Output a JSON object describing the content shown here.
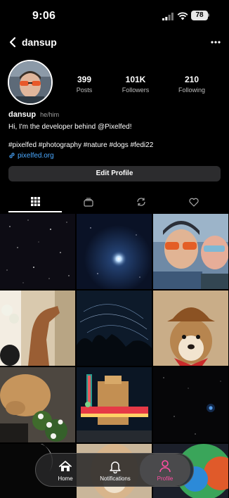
{
  "status_bar": {
    "time": "9:06",
    "battery": "78"
  },
  "header": {
    "username": "dansup"
  },
  "profile": {
    "display_name": "dansup",
    "pronouns": "he/him",
    "bio": "Hi, I'm the developer behind @Pixelfed!",
    "tags": "#pixelfed #photography #nature #dogs #fedi22",
    "link": "pixelfed.org"
  },
  "stats": [
    {
      "value": "399",
      "label": "Posts"
    },
    {
      "value": "101K",
      "label": "Followers"
    },
    {
      "value": "210",
      "label": "Following"
    }
  ],
  "edit_button": "Edit Profile",
  "tabs": [
    "grid-icon",
    "collections-icon",
    "reblog-icon",
    "heart-icon"
  ],
  "tab_bar": {
    "items": [
      {
        "label": "Home",
        "icon": "home-icon"
      },
      {
        "label": "Notifications",
        "icon": "bell-icon"
      },
      {
        "label": "Profile",
        "icon": "person-icon"
      }
    ],
    "active": "Profile"
  },
  "colors": {
    "link": "#4aa8ff",
    "active_tab": "#ff4fa3",
    "button_bg": "#2c2c2e"
  }
}
